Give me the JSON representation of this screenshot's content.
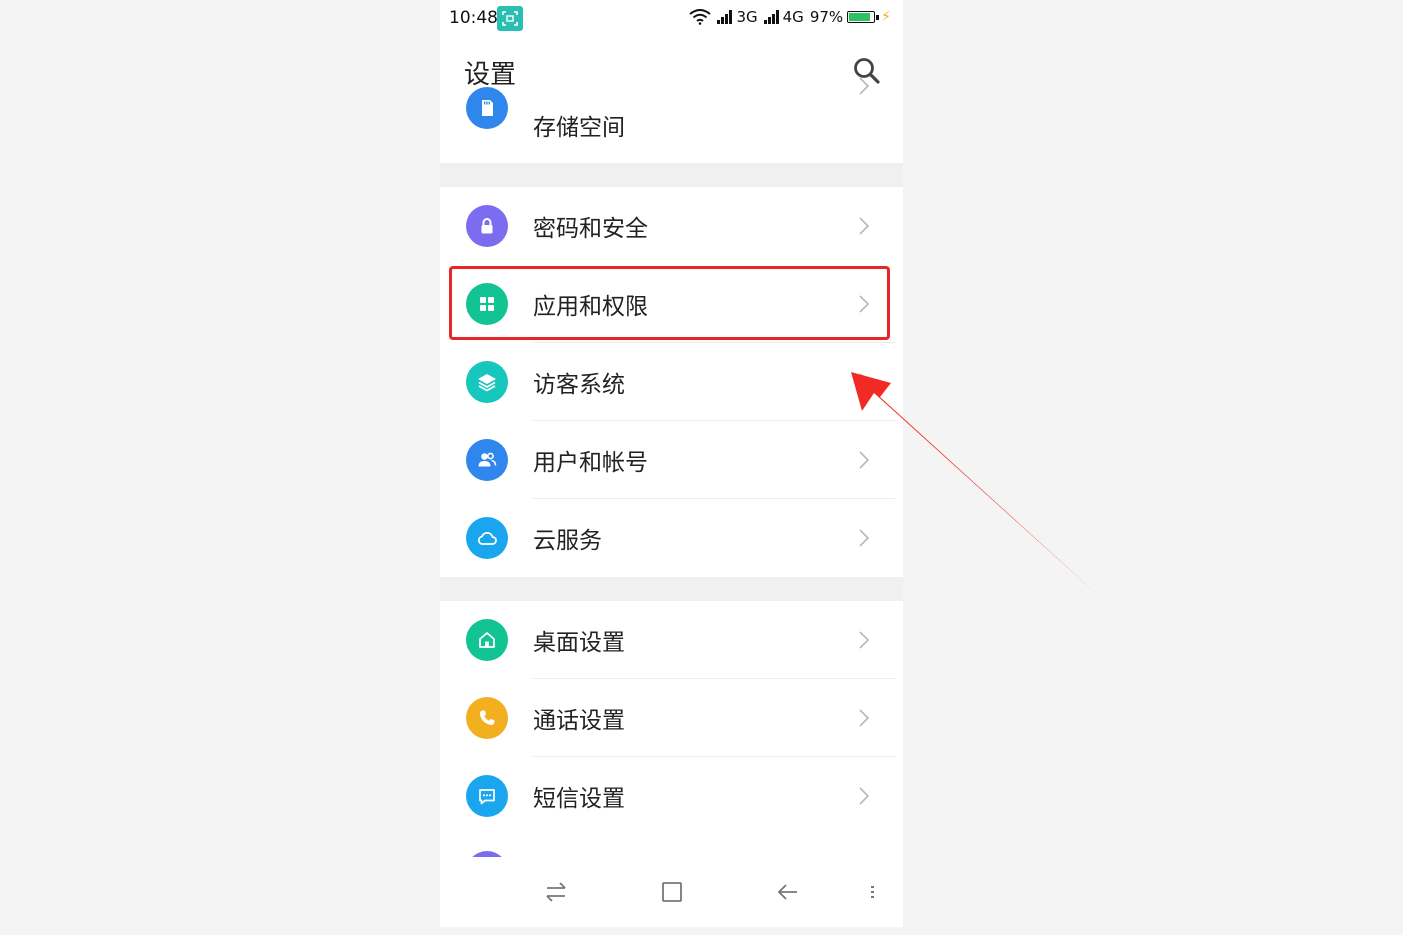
{
  "status_bar": {
    "time": "10:48",
    "network1": "3G",
    "network2": "4G",
    "battery": "97%",
    "battery_level": 0.97
  },
  "header": {
    "title": "设置"
  },
  "groups": [
    {
      "items": [
        {
          "label": "存储空间",
          "icon": "sd-card-icon",
          "color": "#2f86ec"
        }
      ]
    },
    {
      "items": [
        {
          "label": "密码和安全",
          "icon": "lock-icon",
          "color": "#7b6cf0"
        },
        {
          "label": "应用和权限",
          "icon": "apps-grid-icon",
          "color": "#12c493"
        },
        {
          "label": "访客系统",
          "icon": "layers-icon",
          "color": "#17c6bc"
        },
        {
          "label": "用户和帐号",
          "icon": "users-icon",
          "color": "#2f86ec"
        },
        {
          "label": "云服务",
          "icon": "cloud-icon",
          "color": "#1aa6ef"
        }
      ]
    },
    {
      "items": [
        {
          "label": "桌面设置",
          "icon": "home-icon",
          "color": "#12c493"
        },
        {
          "label": "通话设置",
          "icon": "phone-icon",
          "color": "#f2b021"
        },
        {
          "label": "短信设置",
          "icon": "message-icon",
          "color": "#1aa6ef"
        }
      ]
    }
  ],
  "colors": {
    "highlight": "#e8262a",
    "arrow": "#f22a25"
  }
}
